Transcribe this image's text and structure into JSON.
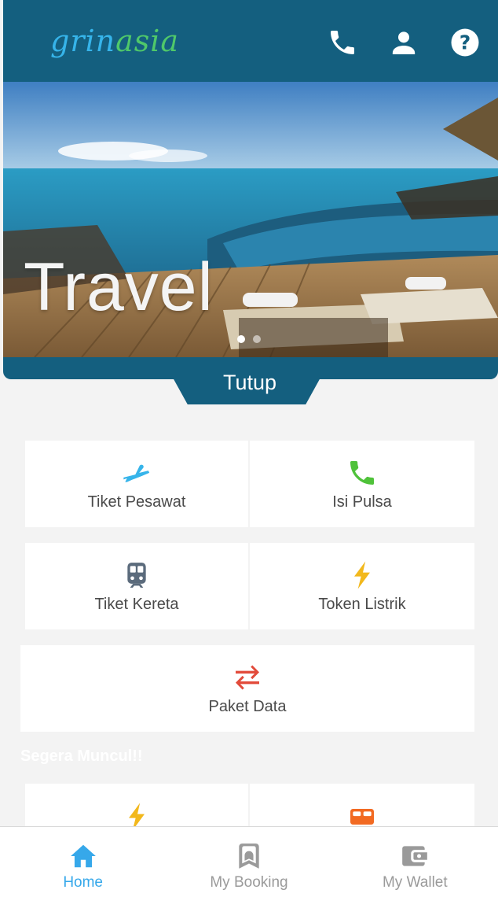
{
  "header": {
    "logo_part1": "grin",
    "logo_part2": "asia",
    "icons": [
      "phone-icon",
      "user-icon",
      "help-icon"
    ]
  },
  "banner": {
    "title": "Travel",
    "slides_total": 2,
    "slide_active": 1,
    "collapse_label": "Tutup"
  },
  "menu": {
    "items": [
      {
        "label": "Tiket Pesawat",
        "icon": "plane-icon",
        "color": "#36b4ea"
      },
      {
        "label": "Isi Pulsa",
        "icon": "phone-icon",
        "color": "#4fc23a"
      },
      {
        "label": "Tiket Kereta",
        "icon": "train-icon",
        "color": "#5b6b7c"
      },
      {
        "label": "Token Listrik",
        "icon": "lightning-icon",
        "color": "#f2b81c"
      },
      {
        "label": "Paket Data",
        "icon": "data-transfer-icon",
        "color": "#e24b3b"
      }
    ]
  },
  "coming_soon": {
    "title": "Segera Muncul!!",
    "items": [
      {
        "icon": "lightning-icon",
        "color": "#f2b81c"
      },
      {
        "icon": "bed-icon",
        "color": "#f26a22"
      }
    ]
  },
  "bottom_nav": {
    "items": [
      {
        "label": "Home",
        "icon": "home-icon",
        "active": true
      },
      {
        "label": "My Booking",
        "icon": "booking-icon",
        "active": false
      },
      {
        "label": "My Wallet",
        "icon": "wallet-icon",
        "active": false
      }
    ]
  },
  "colors": {
    "header_bg": "#145f7f",
    "accent": "#36a8ea",
    "inactive": "#9a9a9a"
  }
}
